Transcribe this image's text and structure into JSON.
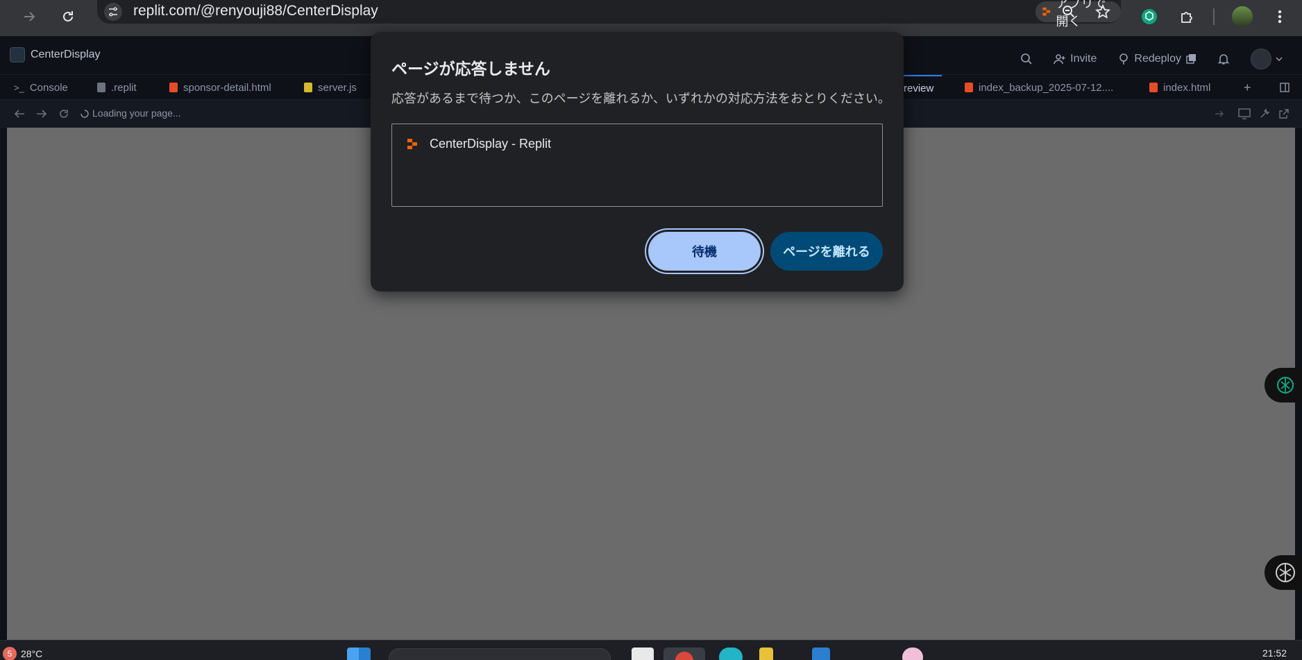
{
  "browser": {
    "url": "replit.com/@renyouji88/CenterDisplay",
    "open_app_label": "アプリで開く"
  },
  "replit": {
    "project_name": "CenterDisplay",
    "invite_label": "Invite",
    "redeploy_label": "Redeploy",
    "tabs": [
      {
        "label": "Console"
      },
      {
        "label": ".replit"
      },
      {
        "label": "sponsor-detail.html"
      },
      {
        "label": "server.js"
      },
      {
        "label": "review"
      },
      {
        "label": "index_backup_2025-07-12...."
      },
      {
        "label": "index.html"
      }
    ],
    "loading_text": "Loading your page..."
  },
  "dialog": {
    "title": "ページが応答しません",
    "message": "応答があるまで待つか、このページを離れるか、いずれかの対応方法をおとりください。",
    "pages": [
      {
        "name": "CenterDisplay - Replit"
      }
    ],
    "wait_label": "待機",
    "leave_label": "ページを離れる"
  },
  "taskbar": {
    "weather_badge": "5",
    "temperature": "28°C",
    "clock": "21:52"
  },
  "colors": {
    "dialog_bg": "#202124",
    "wait_button": "#a8c7fa",
    "leave_button": "#004a77",
    "replit_orange": "#f26207",
    "active_tab_accent": "#2f7df6"
  }
}
